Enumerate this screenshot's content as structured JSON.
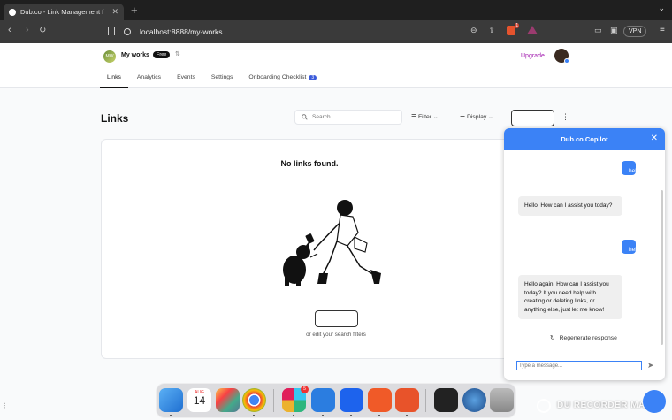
{
  "browser": {
    "tab_title": "Dub.co - Link Management f",
    "url": "localhost:8888/my-works",
    "vpn_label": "VPN",
    "brave_badge": "1"
  },
  "header": {
    "avatar_initials": "MW",
    "workspace_name": "My works",
    "plan_badge": "Free",
    "upgrade_label": "Upgrade",
    "tabs": [
      {
        "label": "Links",
        "active": true
      },
      {
        "label": "Analytics"
      },
      {
        "label": "Events"
      },
      {
        "label": "Settings"
      },
      {
        "label": "Onboarding Checklist",
        "count": "3"
      }
    ]
  },
  "links_page": {
    "title": "Links",
    "search_placeholder": "Search...",
    "filter_label": "Filter",
    "display_label": "Display",
    "empty_title": "No links found.",
    "empty_subtitle": "or edit your search filters"
  },
  "copilot": {
    "title": "Dub.co Copilot",
    "messages": [
      {
        "role": "user",
        "text": "hello"
      },
      {
        "role": "bot",
        "text": "Hello! How can I assist you today?"
      },
      {
        "role": "user",
        "text": "hello"
      },
      {
        "role": "bot",
        "text": "Hello again! How can I assist you today? If you need help with creating or deleting links, or anything else, just let me know!"
      }
    ],
    "regenerate_label": "Regenerate response",
    "input_placeholder": "Type a message..."
  },
  "dock": {
    "calendar_month": "AUG",
    "calendar_day": "14",
    "slack_badge": "5"
  },
  "watermark": "DU RECORDER MAC",
  "colors": {
    "accent": "#3b82f6",
    "upgrade": "#a21caf",
    "count_badge": "#3b5bdb"
  }
}
